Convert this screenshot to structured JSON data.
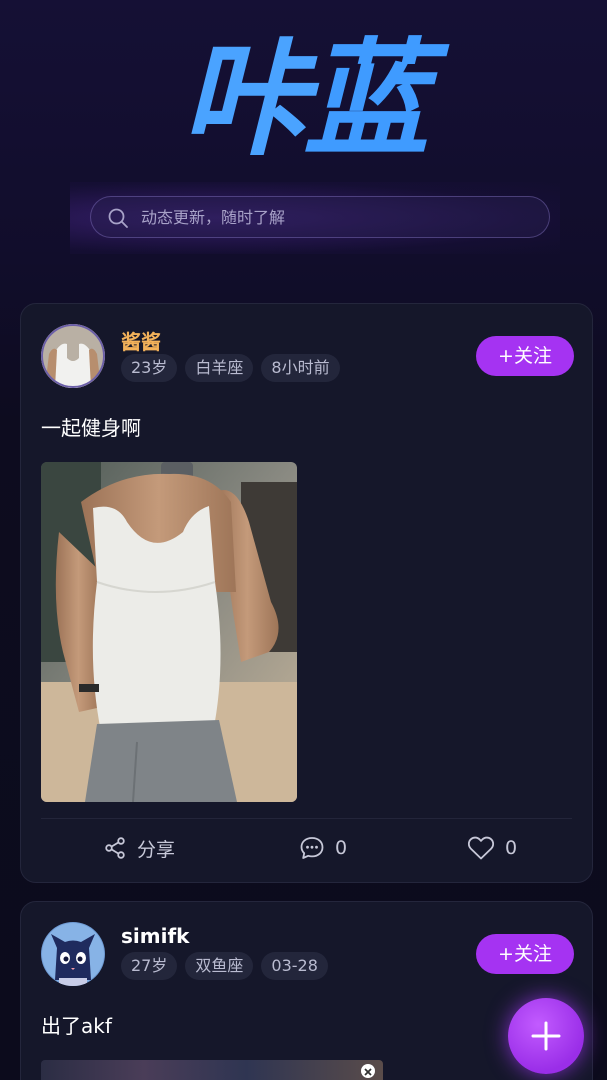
{
  "app": {
    "logo_char1": "咔",
    "logo_char2": "蓝"
  },
  "search": {
    "placeholder": "动态更新，随时了解"
  },
  "posts": [
    {
      "username": "酱酱",
      "username_color": "#f2b15a",
      "tags": [
        "23岁",
        "白羊座",
        "8小时前"
      ],
      "follow_label": "+关注",
      "text": "一起健身啊",
      "share_label": "分享",
      "comment_count": "0",
      "like_count": "0"
    },
    {
      "username": "simifk",
      "username_color": "#ffffff",
      "tags": [
        "27岁",
        "双鱼座",
        "03-28"
      ],
      "follow_label": "+关注",
      "text": "出了akf"
    }
  ],
  "colors": {
    "accent": "#a533f2",
    "background": "#0c0b1c",
    "card": "#15172a"
  },
  "icons": [
    "search-icon",
    "share-icon",
    "comment-icon",
    "heart-icon",
    "plus-icon",
    "close-icon"
  ]
}
